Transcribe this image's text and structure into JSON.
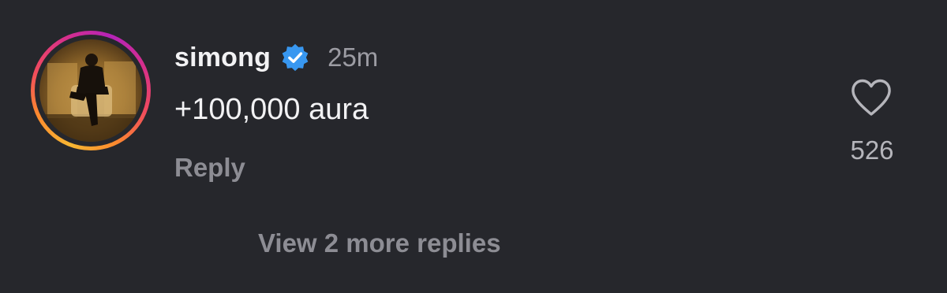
{
  "comment": {
    "username": "simong",
    "verified": true,
    "timestamp": "25m",
    "text": "+100,000 aura",
    "reply_label": "Reply",
    "view_replies_label": "View 2 more replies",
    "like_count": "526"
  },
  "icons": {
    "verified": "verified-badge-icon",
    "like": "heart-icon"
  },
  "colors": {
    "background": "#26272c",
    "verified_badge": "#3897f0",
    "muted_text": "#8d8d94"
  }
}
